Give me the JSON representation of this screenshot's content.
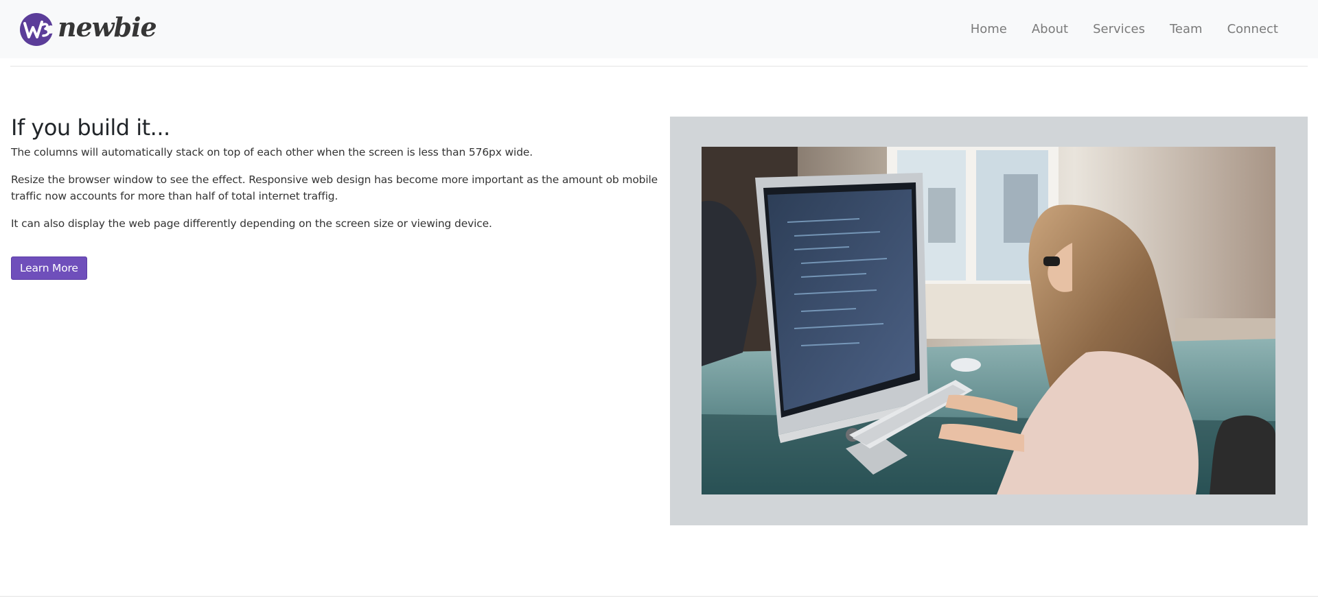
{
  "navbar": {
    "brand_text": "newbie",
    "logo_letters": "WB",
    "links": [
      "Home",
      "About",
      "Services",
      "Team",
      "Connect"
    ]
  },
  "hero": {
    "title": "If you build it...",
    "paragraphs": [
      "The columns will automatically stack on top of each other when the screen is less than 576px wide.",
      "Resize the browser window to see the effect. Responsive web design has become more important as the amount ob mobile traffic now accounts for more than half of total internet traffig.",
      "It can also display the web page differently depending on the screen size or viewing device."
    ],
    "button_label": "Learn More"
  },
  "image": {
    "subject": "woman-typing-at-imac-photo"
  },
  "colors": {
    "brand_purple": "#6f4fbb",
    "navbar_bg": "#f8f9fa",
    "image_panel_bg": "#d1d5d8",
    "nav_text": "#7a7a7a"
  }
}
